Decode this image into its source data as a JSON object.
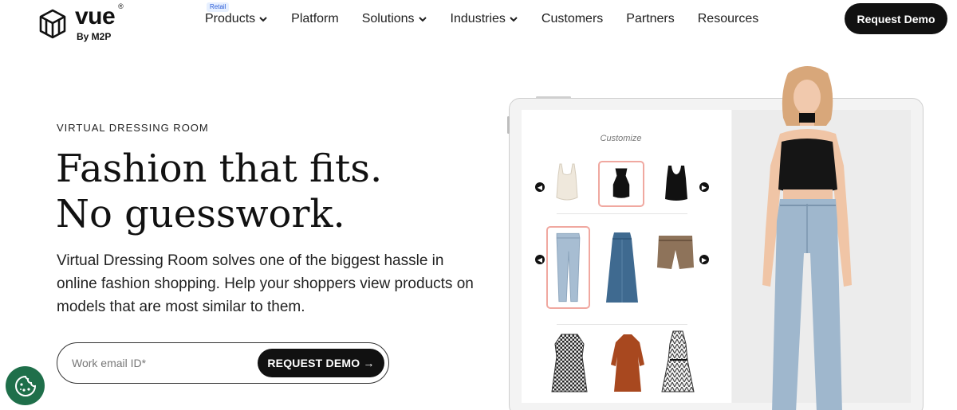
{
  "header": {
    "logo": {
      "word": "vue",
      "reg": "®",
      "sub": "By M2P"
    },
    "nav": [
      {
        "label": "Products",
        "has_dropdown": true,
        "badge": "Retail"
      },
      {
        "label": "Platform",
        "has_dropdown": false
      },
      {
        "label": "Solutions",
        "has_dropdown": true
      },
      {
        "label": "Industries",
        "has_dropdown": true
      },
      {
        "label": "Customers",
        "has_dropdown": false
      },
      {
        "label": "Partners",
        "has_dropdown": false
      },
      {
        "label": "Resources",
        "has_dropdown": false
      }
    ],
    "cta_label": "Request Demo"
  },
  "hero": {
    "eyebrow": "VIRTUAL DRESSING ROOM",
    "headline_line1": "Fashion that fits.",
    "headline_line2": "No guesswork.",
    "subcopy": "Virtual Dressing Room solves one of the biggest hassle in online fashion shopping. Help your shoppers view products on models that are most similar to them.",
    "email_placeholder": "Work email ID*",
    "submit_label": "REQUEST DEMO →"
  },
  "mockup": {
    "customize_label": "Customize",
    "rows": [
      {
        "items": [
          "cream-crop-top",
          "black-halter-top",
          "black-tank-top"
        ],
        "selected_index": 1
      },
      {
        "items": [
          "light-wash-jeans",
          "denim-midi-skirt",
          "brown-shorts"
        ],
        "selected_index": 0
      },
      {
        "items": [
          "houndstooth-dress",
          "rust-knit-dress",
          "patterned-slip-dress"
        ],
        "selected_index": -1
      }
    ]
  },
  "colors": {
    "primary": "#111111",
    "accent_selected": "#f0a8a0",
    "cookie_bg": "#1f6f4a",
    "badge_bg": "#e7f0ff",
    "badge_text": "#2a5bd7"
  },
  "icons": {
    "logo": "vue-cube-logo-icon",
    "nav_dropdown": "chevron-down-icon",
    "arrow_left": "chevron-left-icon",
    "arrow_right": "chevron-right-icon",
    "cookie": "cookie-icon"
  }
}
